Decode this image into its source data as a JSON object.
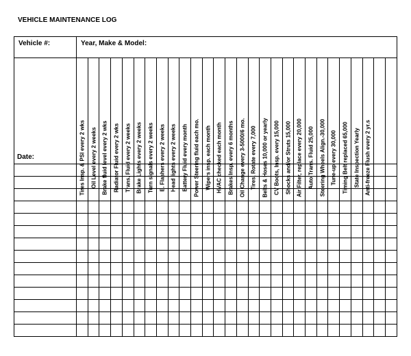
{
  "title": "VEHICLE MAINTENANCE LOG",
  "header": {
    "vehicle_label": "Vehicle #:",
    "ymm_label": "Year, Make & Model:",
    "date_label": "Date:"
  },
  "columns": [
    "Tires Insp. & PSI every 2 wks",
    "Oil Level every 2 weeks",
    "Brake fluid level every 2 wks",
    "Radiator Fluid every 2 wks",
    "Trans. Fluid every 2 weeks",
    "Brake Lights every 2 weeks",
    "Turn signals every 2 weeks",
    "E. Flashers every 2 weeks",
    "Head lights every 2 weeks",
    "Battery Fluid every month",
    "Power Steering fluid each mo.",
    "Wipers insp. each month",
    "HVAC checked each month",
    "Brakes Insp. every 6 months",
    "Oil Change every 3-5000/6 mo.",
    "Tires, Rotate every 7,000",
    "Belts & Hoses 10,000 or yearly",
    "CV Boots, Insp. every 15,000",
    "Shocks and/or Struts 15,000",
    "Air Filter, replace every 20,000",
    "Auto Trans. Fluid 25,000",
    "Steering Wheels Align.-30,000",
    "Tune-up every 30,000",
    "Timing Belt replaced 65,000",
    "State Inspection Yearly",
    "Anti-freeze Flush every 2 yr.s",
    "",
    ""
  ],
  "row_count": 14
}
